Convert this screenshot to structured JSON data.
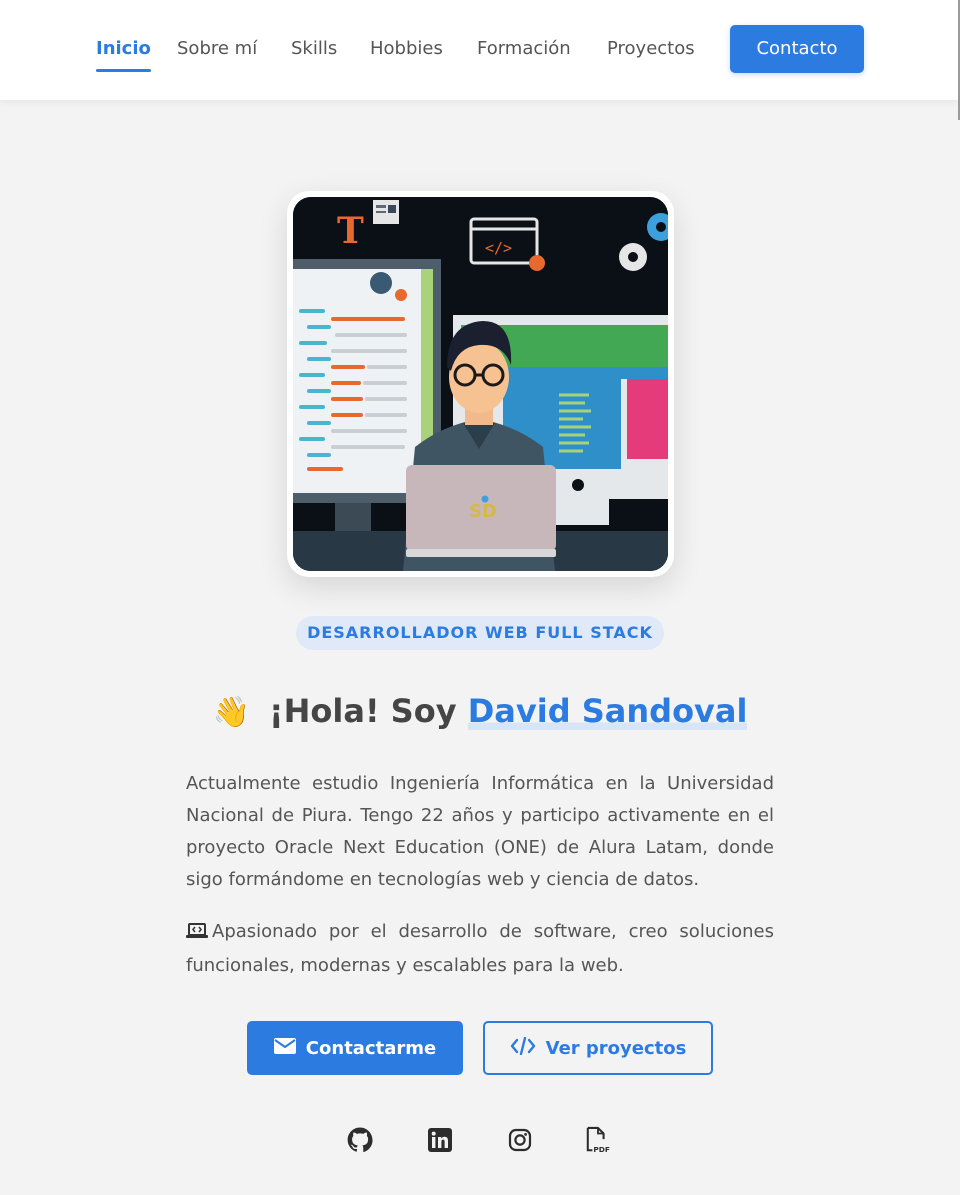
{
  "nav": {
    "items": [
      {
        "label": "Inicio",
        "active": true
      },
      {
        "label": "Sobre mí",
        "active": false
      },
      {
        "label": "Skills",
        "active": false
      },
      {
        "label": "Hobbies",
        "active": false
      },
      {
        "label": "Formación",
        "active": false
      },
      {
        "label": "Proyectos",
        "active": false
      }
    ],
    "contact_label": "Contacto"
  },
  "hero": {
    "image_icon": "developer-illustration",
    "laptop_logo_text": "SD",
    "role_badge": "DESARROLLADOR WEB FULL STACK",
    "greeting_emoji": "👋",
    "greeting_prefix": "¡Hola! Soy",
    "name": "David Sandoval",
    "paragraph1": "Actualmente estudio Ingeniería Informática en la Universidad Nacional de Piura. Tengo 22 años y participo activamente en el proyecto Oracle Next Education (ONE) de Alura Latam, donde sigo formándome en tecnologías web y ciencia de datos.",
    "paragraph2": "Apasionado por el desarrollo de software, creo soluciones funcionales, modernas y escalables para la web.",
    "paragraph2_icon": "laptop-code-icon"
  },
  "buttons": {
    "contact_label": "Contactarme",
    "contact_icon": "envelope-icon",
    "projects_label": "Ver proyectos",
    "projects_icon": "code-icon"
  },
  "social": [
    {
      "name": "github",
      "icon": "github-icon"
    },
    {
      "name": "linkedin",
      "icon": "linkedin-icon"
    },
    {
      "name": "instagram",
      "icon": "instagram-icon"
    },
    {
      "name": "cv-pdf",
      "icon": "pdf-file-icon"
    }
  ],
  "colors": {
    "accent": "#2b7be0",
    "background": "#f3f3f3",
    "badge_bg": "#dfe9f7",
    "text": "#555555"
  }
}
